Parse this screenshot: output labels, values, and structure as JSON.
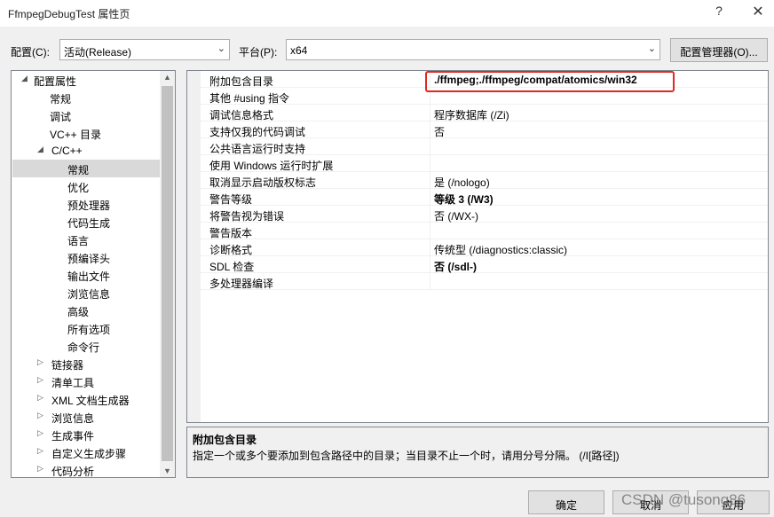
{
  "window": {
    "title": "FfmpegDebugTest 属性页",
    "help_label": "?",
    "close_label": "✕"
  },
  "toolbar": {
    "config_label": "配置(C):",
    "config_value": "活动(Release)",
    "platform_label": "平台(P):",
    "platform_value": "x64",
    "config_manager_label": "配置管理器(O)..."
  },
  "tree": {
    "items": [
      {
        "label": "配置属性",
        "arrow": "◢"
      },
      {
        "label": "常规",
        "arrow": ""
      },
      {
        "label": "调试",
        "arrow": ""
      },
      {
        "label": "VC++ 目录",
        "arrow": ""
      },
      {
        "label": "C/C++",
        "arrow": "◢"
      },
      {
        "label": "常规",
        "arrow": ""
      },
      {
        "label": "优化",
        "arrow": ""
      },
      {
        "label": "预处理器",
        "arrow": ""
      },
      {
        "label": "代码生成",
        "arrow": ""
      },
      {
        "label": "语言",
        "arrow": ""
      },
      {
        "label": "预编译头",
        "arrow": ""
      },
      {
        "label": "输出文件",
        "arrow": ""
      },
      {
        "label": "浏览信息",
        "arrow": ""
      },
      {
        "label": "高级",
        "arrow": ""
      },
      {
        "label": "所有选项",
        "arrow": ""
      },
      {
        "label": "命令行",
        "arrow": ""
      },
      {
        "label": "链接器",
        "arrow": "▷"
      },
      {
        "label": "清单工具",
        "arrow": "▷"
      },
      {
        "label": "XML 文档生成器",
        "arrow": "▷"
      },
      {
        "label": "浏览信息",
        "arrow": "▷"
      },
      {
        "label": "生成事件",
        "arrow": "▷"
      },
      {
        "label": "自定义生成步骤",
        "arrow": "▷"
      },
      {
        "label": "代码分析",
        "arrow": "▷"
      }
    ],
    "scroll_up": "▲",
    "scroll_down": "▼"
  },
  "properties": [
    {
      "name": "附加包含目录",
      "value": "./ffmpeg;./ffmpeg/compat/atomics/win32",
      "bold": true
    },
    {
      "name": "其他 #using 指令",
      "value": "",
      "bold": false
    },
    {
      "name": "调试信息格式",
      "value": "程序数据库 (/Zi)",
      "bold": false
    },
    {
      "name": "支持仅我的代码调试",
      "value": "否",
      "bold": false
    },
    {
      "name": "公共语言运行时支持",
      "value": "",
      "bold": false
    },
    {
      "name": "使用 Windows 运行时扩展",
      "value": "",
      "bold": false
    },
    {
      "name": "取消显示启动版权标志",
      "value": "是 (/nologo)",
      "bold": false
    },
    {
      "name": "警告等级",
      "value": "等级 3 (/W3)",
      "bold": true
    },
    {
      "name": "将警告视为错误",
      "value": "否 (/WX-)",
      "bold": false
    },
    {
      "name": "警告版本",
      "value": "",
      "bold": false
    },
    {
      "name": "诊断格式",
      "value": "传统型 (/diagnostics:classic)",
      "bold": false
    },
    {
      "name": "SDL 检查",
      "value": "否 (/sdl-)",
      "bold": true
    },
    {
      "name": "多处理器编译",
      "value": "",
      "bold": false
    }
  ],
  "description": {
    "title": "附加包含目录",
    "text": "指定一个或多个要添加到包含路径中的目录；当目录不止一个时，请用分号分隔。     (/I[路径])"
  },
  "buttons": {
    "ok": "确定",
    "cancel": "取消",
    "apply": "应用"
  },
  "watermark": "CSDN @tusong86",
  "colors": {
    "highlight_border": "#e0291f",
    "selected_tree_bg": "#d9d9d9"
  }
}
